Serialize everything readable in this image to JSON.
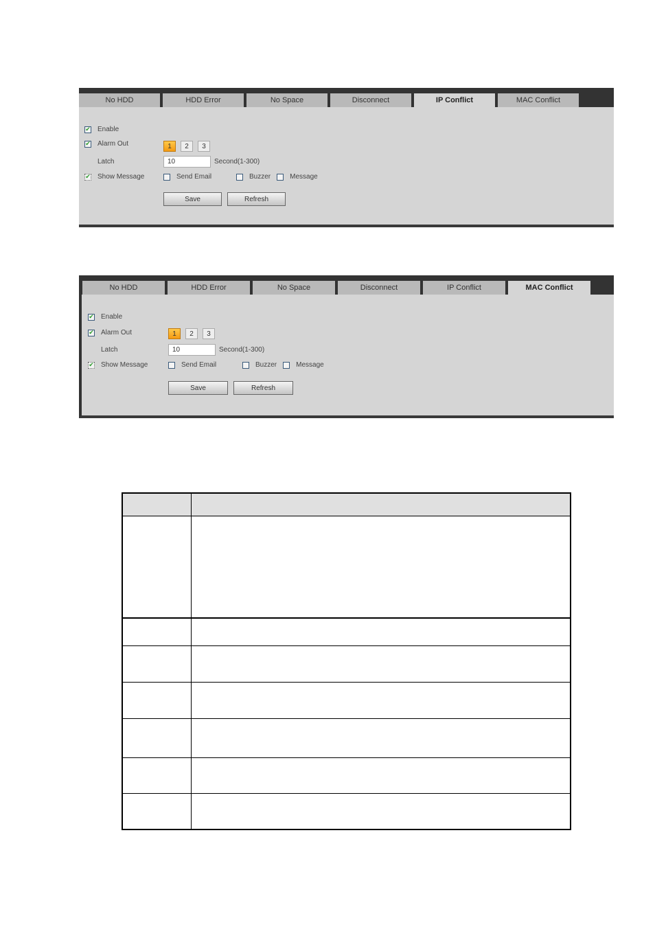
{
  "panels": [
    {
      "tabs": [
        {
          "label": "No HDD",
          "active": false
        },
        {
          "label": "HDD Error",
          "active": false
        },
        {
          "label": "No Space",
          "active": false
        },
        {
          "label": "Disconnect",
          "active": false
        },
        {
          "label": "IP Conflict",
          "active": true
        },
        {
          "label": "MAC Conflict",
          "active": false
        }
      ],
      "enable": {
        "label": "Enable",
        "checked": true
      },
      "alarm_out": {
        "label": "Alarm Out",
        "checked": true,
        "channels": [
          "1",
          "2",
          "3"
        ],
        "selected": "1"
      },
      "latch": {
        "label": "Latch",
        "value": "10",
        "unit": "Second(1-300)"
      },
      "show_message": {
        "label": "Show Message",
        "checked": true
      },
      "send_email": {
        "label": "Send Email",
        "checked": false
      },
      "buzzer": {
        "label": "Buzzer",
        "checked": false
      },
      "message": {
        "label": "Message",
        "checked": false
      },
      "save_label": "Save",
      "refresh_label": "Refresh"
    },
    {
      "tabs": [
        {
          "label": "No HDD",
          "active": false
        },
        {
          "label": "HDD Error",
          "active": false
        },
        {
          "label": "No Space",
          "active": false
        },
        {
          "label": "Disconnect",
          "active": false
        },
        {
          "label": "IP Conflict",
          "active": false
        },
        {
          "label": "MAC Conflict",
          "active": true
        }
      ],
      "enable": {
        "label": "Enable",
        "checked": true
      },
      "alarm_out": {
        "label": "Alarm Out",
        "checked": true,
        "channels": [
          "1",
          "2",
          "3"
        ],
        "selected": "1"
      },
      "latch": {
        "label": "Latch",
        "value": "10",
        "unit": "Second(1-300)"
      },
      "show_message": {
        "label": "Show Message",
        "checked": true
      },
      "send_email": {
        "label": "Send Email",
        "checked": false
      },
      "buzzer": {
        "label": "Buzzer",
        "checked": false
      },
      "message": {
        "label": "Message",
        "checked": false
      },
      "save_label": "Save",
      "refresh_label": "Refresh"
    }
  ],
  "table": {
    "headers": [
      "",
      ""
    ],
    "rows": [
      [
        "",
        ""
      ],
      [
        "",
        ""
      ],
      [
        "",
        ""
      ],
      [
        "",
        ""
      ],
      [
        "",
        ""
      ],
      [
        "",
        ""
      ],
      [
        "",
        ""
      ]
    ]
  }
}
